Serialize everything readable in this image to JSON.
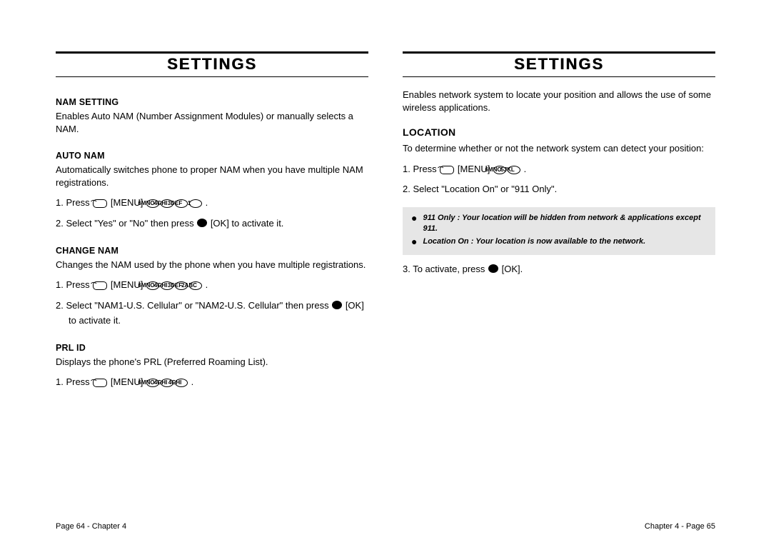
{
  "left": {
    "title": "SETTINGS",
    "sections": {
      "nam_setting": {
        "heading": "NAM SETTING",
        "body": "Enables Auto NAM (Number Assignment Modules) or manually selects a NAM."
      },
      "auto_nam": {
        "heading": "AUTO NAM",
        "body": "Automatically switches phone to proper NAM when you have multiple NAM registrations.",
        "step1_prefix": "1. Press ",
        "step1_menu": " [MENU] ",
        "step1_keys": [
          "6MNO",
          "4GHI",
          "3DEF",
          "1"
        ],
        "step1_suffix": " .",
        "step2_prefix": "2. Select \"Yes\" or \"No\" then press ",
        "step2_ok": " [OK] to activate it."
      },
      "change_nam": {
        "heading": "CHANGE NAM",
        "body": "Changes the NAM used by the phone when you have multiple registrations.",
        "step1_prefix": "1. Press ",
        "step1_menu": " [MENU] ",
        "step1_keys": [
          "6MNO",
          "4GHI",
          "3DEF",
          "2ABC"
        ],
        "step1_suffix": " .",
        "step2_prefix": "2. Select \"NAM1-U.S. Cellular\" or \"NAM2-U.S. Cellular\" then press ",
        "step2_ok": " [OK] to activate it."
      },
      "prl_id": {
        "heading": "PRL ID",
        "body": "Displays the phone's PRL (Preferred Roaming List).",
        "step1_prefix": "1. Press ",
        "step1_menu": " [MENU] ",
        "step1_keys": [
          "6MNO",
          "4GHI",
          "4GHI"
        ],
        "step1_suffix": " ."
      }
    },
    "footer": "Page 64 - Chapter 4"
  },
  "right": {
    "title": "SETTINGS",
    "intro": "Enables network system to locate your position and allows the use of some wireless applications.",
    "location": {
      "heading": "LOCATION",
      "body": "To determine whether or not the network system can detect your position:",
      "step1_prefix": "1. Press ",
      "step1_menu": " [MENU] ",
      "step1_keys": [
        "6MNO",
        "5JKL"
      ],
      "step1_suffix": " .",
      "step2": "2. Select \"Location On\" or \"911 Only\".",
      "note1": "911 Only : Your location will be hidden from network & applications except 911.",
      "note2": "Location On : Your location is now available to the network.",
      "step3_prefix": "3. To activate, press ",
      "step3_ok": " [OK]."
    },
    "footer": "Chapter 4 - Page 65"
  },
  "icons": {
    "softkey": "⌒"
  }
}
